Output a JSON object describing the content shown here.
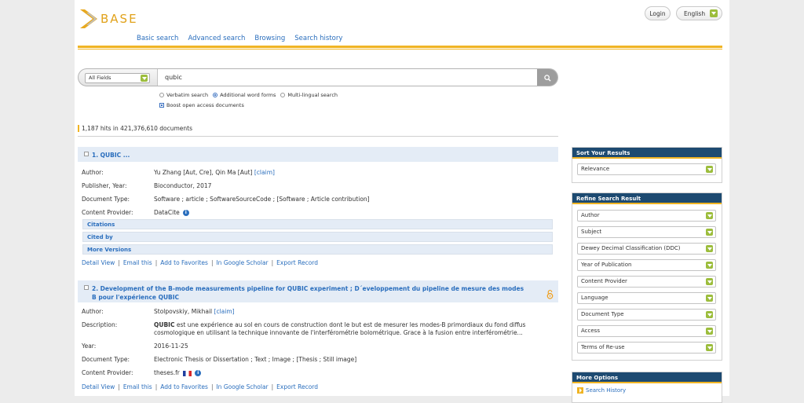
{
  "app": {
    "logo_text": "BASE"
  },
  "header": {
    "login_label": "Login",
    "language_label": "English",
    "nav": [
      "Basic search",
      "Advanced search",
      "Browsing",
      "Search history"
    ]
  },
  "search": {
    "field_selected": "All Fields",
    "query": "qubic",
    "options": [
      "Verbatim search",
      "Additional word forms",
      "Multi-lingual search"
    ],
    "selected_option": "Additional word forms",
    "boost_label": "Boost open access documents",
    "boost_checked": true
  },
  "hits_text": "1,187 hits in 421,376,610 documents",
  "results": [
    {
      "title": "1. QUBIC ...",
      "fields": [
        {
          "label": "Author:",
          "value": "Yu Zhang [Aut, Cre], Qin Ma [Aut]",
          "claim": "[claim]"
        },
        {
          "label": "Publisher, Year:",
          "value": "Bioconductor, 2017"
        },
        {
          "label": "Document Type:",
          "value": "Software ; article ; SoftwareSourceCode ; [Software ; Article contribution]"
        },
        {
          "label": "Content Provider:",
          "value": "DataCite"
        }
      ],
      "bars": [
        "Citations",
        "Cited by",
        "More Versions"
      ],
      "actions": [
        "Detail View",
        "Email this",
        "Add to Favorites",
        "In Google Scholar",
        "Export Record"
      ]
    },
    {
      "title": "2. Development of the B-mode measurements pipeline for QUBIC experiment ; D´eveloppement du pipeline de mesure des modes B pour l'expérience QUBIC",
      "fields": [
        {
          "label": "Author:",
          "value": "Stolpovskiy, Mikhail",
          "claim": "[claim]"
        },
        {
          "label": "Description:",
          "value_bold": "QUBIC",
          "value": " est une expérience au sol en cours de construction dont le but est de mesurer les modes-B primordiaux du fond diffus cosmologique en utilisant la technique innovante de l'interférométrie bolométrique. Grace à la fusion entre interférométrie..."
        },
        {
          "label": "Year:",
          "value": "2016-11-25"
        },
        {
          "label": "Document Type:",
          "value": "Electronic Thesis or Dissertation ; Text ; Image ; [Thesis ; Still image]"
        },
        {
          "label": "Content Provider:",
          "value": "theses.fr"
        }
      ],
      "actions": [
        "Detail View",
        "Email this",
        "Add to Favorites",
        "In Google Scholar",
        "Export Record"
      ]
    }
  ],
  "sidebar": {
    "sort": {
      "title": "Sort Your Results",
      "selected": "Relevance"
    },
    "refine": {
      "title": "Refine Search Result",
      "filters": [
        "Author",
        "Subject",
        "Dewey Decimal Classification (DDC)",
        "Year of Publication",
        "Content Provider",
        "Language",
        "Document Type",
        "Access",
        "Terms of Re-use"
      ]
    },
    "more": {
      "title": "More Options",
      "items": [
        "Search History"
      ]
    }
  },
  "colors": {
    "accent": "#f0b423",
    "link": "#2a6ebd",
    "sidebar_header": "#1d4a71",
    "dropdown_icon": "#9cbd3c"
  }
}
